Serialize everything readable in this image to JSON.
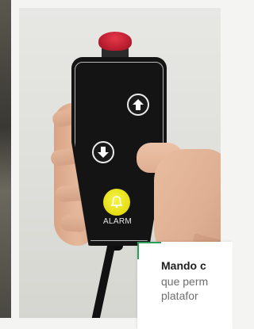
{
  "left_photo": {
    "icon": "photo-strip"
  },
  "main_photo": {
    "pendant": {
      "estop_icon": "emergency-stop-button",
      "up_icon": "arrow-up-icon",
      "down_icon": "arrow-down-icon",
      "alarm_icon": "bell-icon",
      "alarm_label": "ALARM"
    }
  },
  "caption": {
    "title": "Mando c",
    "line1": "que perm",
    "line2": "platafor",
    "accent_color": "#2a9d5a"
  }
}
